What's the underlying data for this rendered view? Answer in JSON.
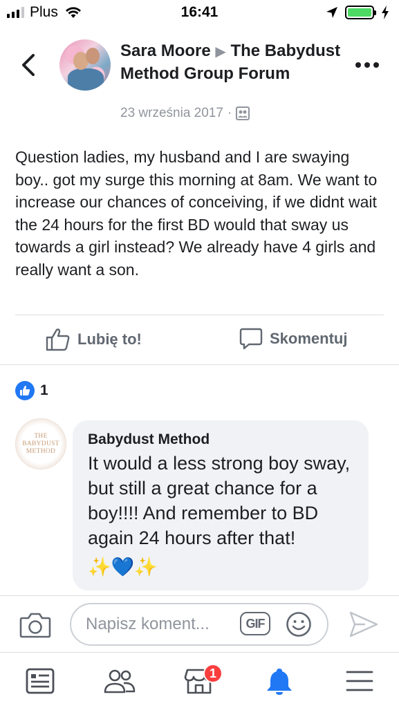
{
  "status_bar": {
    "carrier": "Plus",
    "time": "16:41",
    "colors": {
      "battery": "#4cd964"
    }
  },
  "post": {
    "author": "Sara Moore",
    "group": "The Babydust Method Group Forum",
    "date": "23 września 2017",
    "audience_icon": "group-icon",
    "text": "Question ladies, my husband and I are swaying boy.. got my surge this morning at 8am. We want to increase our chances of conceiving, if we didnt wait the 24 hours for the first BD would that sway us towards a girl instead? We already have 4 girls and really want a son."
  },
  "actions": {
    "like_label": "Lubię to!",
    "comment_label": "Skomentuj"
  },
  "reactions": {
    "count": "1",
    "icon": "thumbs-up-icon",
    "color": "#2078f4"
  },
  "comment": {
    "avatar_text": "THE BABYDUST METHOD",
    "author": "Babydust Method",
    "text": "It would a less strong boy sway, but still a great chance for a boy!!!! And remember to BD again 24 hours after that!",
    "emoji": "✨💙✨"
  },
  "composer": {
    "placeholder": "Napisz koment...",
    "gif_label": "GIF"
  },
  "tab_bar": {
    "items": [
      {
        "name": "news-feed",
        "icon": "news-feed-icon"
      },
      {
        "name": "friends",
        "icon": "friends-icon"
      },
      {
        "name": "marketplace",
        "icon": "marketplace-icon",
        "badge": "1"
      },
      {
        "name": "notifications",
        "icon": "bell-icon",
        "active": true
      },
      {
        "name": "menu",
        "icon": "hamburger-icon"
      }
    ],
    "colors": {
      "active": "#2078f4",
      "inactive": "#4b4f56",
      "badge": "#fa3e3e"
    }
  }
}
